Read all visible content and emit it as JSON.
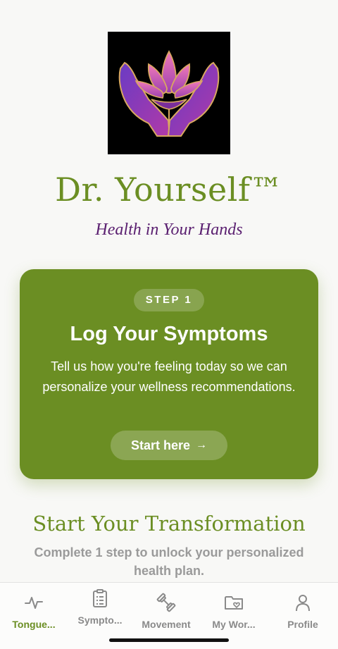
{
  "app": {
    "title": "Dr. Yourself™",
    "tagline": "Health in Your Hands",
    "logo_icon": "lotus-hands-icon"
  },
  "step_card": {
    "badge": "STEP 1",
    "title": "Log Your Symptoms",
    "description": "Tell us how you're feeling today so we can personalize your wellness recommendations.",
    "button_label": "Start here",
    "color": "#6b8e23"
  },
  "section": {
    "title": "Start Your Transformation",
    "description": "Complete 1 step to unlock your personalized health plan."
  },
  "tabs": [
    {
      "label": "Tongue...",
      "icon": "pulse-icon",
      "active": true
    },
    {
      "label": "Sympto...",
      "icon": "clipboard-icon",
      "active": false
    },
    {
      "label": "Movement",
      "icon": "dumbbell-icon",
      "active": false
    },
    {
      "label": "My Wor...",
      "icon": "folder-heart-icon",
      "active": false
    },
    {
      "label": "Profile",
      "icon": "person-icon",
      "active": false
    }
  ],
  "colors": {
    "accent": "#6b8e23",
    "tagline": "#5a1f70",
    "inactive_tab": "#8a8a8a"
  }
}
